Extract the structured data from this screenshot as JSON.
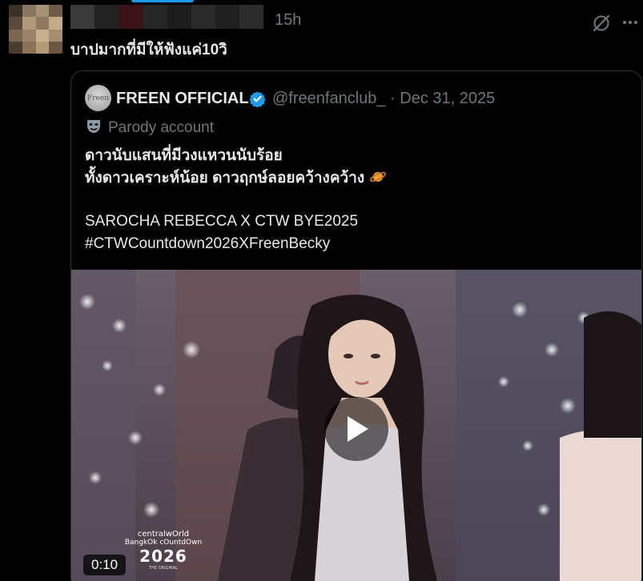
{
  "tweet": {
    "time": "15h",
    "text": "บาปมากที่มีให้ฟังแค่10วิ"
  },
  "quote": {
    "display_name": "FREEN OFFICIAL",
    "avatar_text": "Freen",
    "handle_date": "@freenfanclub_ · Dec 31, 2025",
    "parody_label": "Parody account",
    "lines": [
      "ดาวนับแสนที่มีวงแหวนนับร้อย",
      "ทั้งดาวเคราะห์น้อย ดาวฤกษ์ลอยคว้างคว้าง",
      "SAROCHA REBECCA X CTW BYE2025",
      "#CTWCountdown2026XFreenBecky"
    ]
  },
  "video": {
    "duration": "0:10",
    "brand_line1": "centralwOrld",
    "brand_line2": "BangkOk cOuntdOwn",
    "brand_year": "2026",
    "brand_tag": "THE ORIGINAL"
  },
  "colors": {
    "accent": "#1d9bf0",
    "background": "#000000",
    "text_primary": "#e7e9ea",
    "text_secondary": "#71767b",
    "border": "#2f3336"
  },
  "icons": {
    "grok": "grok-icon",
    "more": "more-icon",
    "verified": "verified-badge-icon",
    "parody": "parody-mask-icon",
    "planet": "ringed-planet-icon",
    "play": "play-icon"
  }
}
